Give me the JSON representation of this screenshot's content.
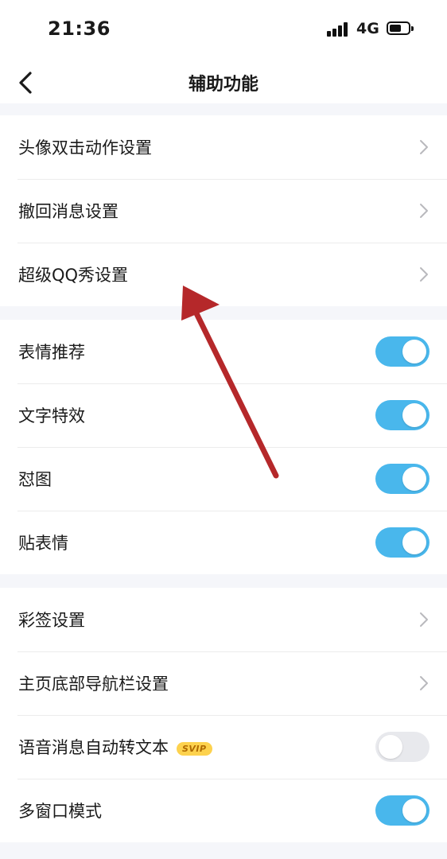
{
  "status_bar": {
    "time": "21:36",
    "network": "4G"
  },
  "nav": {
    "title": "辅助功能"
  },
  "groups": [
    {
      "items": [
        {
          "label": "头像双击动作设置",
          "type": "link"
        },
        {
          "label": "撤回消息设置",
          "type": "link"
        },
        {
          "label": "超级QQ秀设置",
          "type": "link"
        }
      ]
    },
    {
      "items": [
        {
          "label": "表情推荐",
          "type": "toggle",
          "on": true
        },
        {
          "label": "文字特效",
          "type": "toggle",
          "on": true
        },
        {
          "label": "怼图",
          "type": "toggle",
          "on": true
        },
        {
          "label": "贴表情",
          "type": "toggle",
          "on": true
        }
      ]
    },
    {
      "items": [
        {
          "label": "彩签设置",
          "type": "link"
        },
        {
          "label": "主页底部导航栏设置",
          "type": "link"
        },
        {
          "label": "语音消息自动转文本",
          "type": "toggle",
          "on": false,
          "badge": "SVIP"
        },
        {
          "label": "多窗口模式",
          "type": "toggle",
          "on": true
        }
      ]
    }
  ],
  "colors": {
    "toggle_on": "#49b7ec",
    "toggle_off": "#e8e9ed",
    "annotation_arrow": "#b5282a",
    "svip_badge": "#fdd24e"
  }
}
